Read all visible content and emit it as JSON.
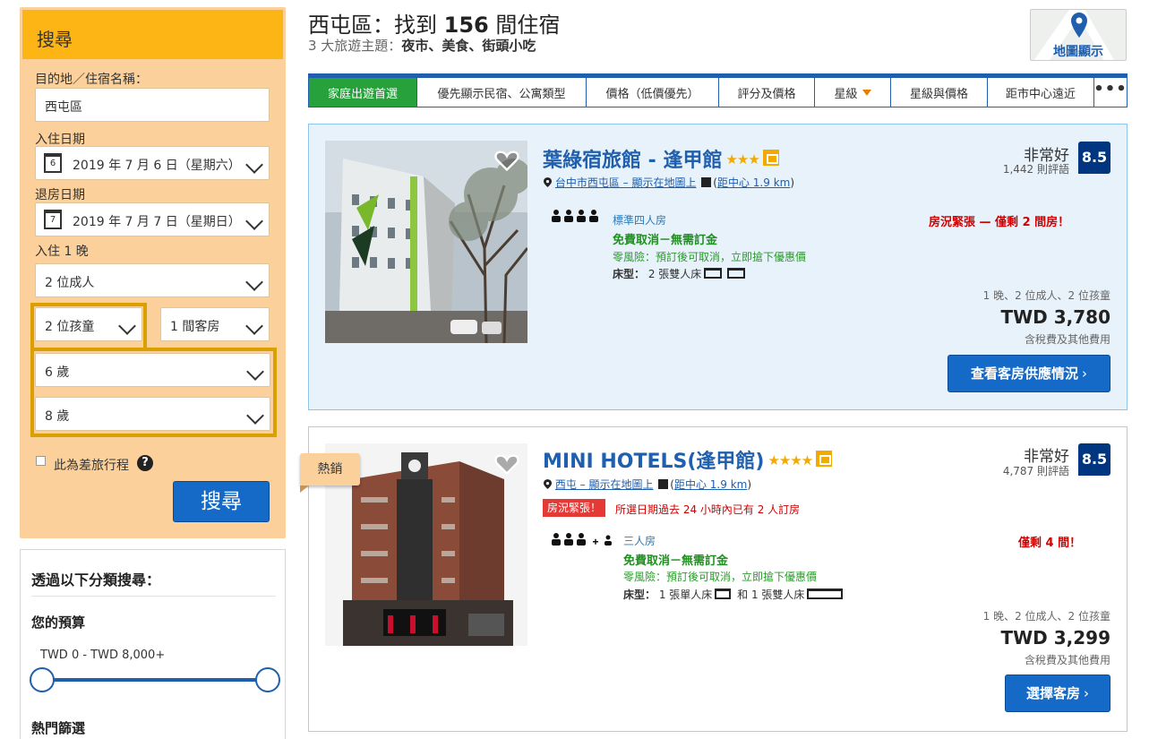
{
  "search": {
    "header": "搜尋",
    "destination_label": "目的地／住宿名稱：",
    "destination_value": "西屯區",
    "checkin_label": "入住日期",
    "checkin_day": "6",
    "checkin_value": "2019 年 7 月 6 日（星期六）",
    "checkout_label": "退房日期",
    "checkout_day": "7",
    "checkout_value": "2019 年 7 月 7 日（星期日）",
    "nights_label": "入住 1 晚",
    "adults": "2 位成人",
    "children": "2 位孩童",
    "rooms": "1 間客房",
    "child_age_1": "6 歲",
    "child_age_2": "8 歲",
    "business_trip_label": "此為差旅行程",
    "help": "?",
    "button": "搜尋"
  },
  "filters": {
    "title": "透過以下分類搜尋：",
    "budget_title": "您的預算",
    "budget_range": "TWD 0 - TWD 8,000+",
    "popular_title": "熱門篩選"
  },
  "header": {
    "title_prefix": "西屯區：找到 ",
    "title_count": "156",
    "title_suffix": " 間住宿",
    "subtitle_prefix": "3 大旅遊主題：",
    "subtitle_themes": "夜市、美食、街頭小吃",
    "map_button": "地圖顯示"
  },
  "sort_tabs": [
    {
      "label": "家庭出遊首選"
    },
    {
      "label": "優先顯示民宿、公寓類型"
    },
    {
      "label": "價格（低價優先）"
    },
    {
      "label": "評分及價格"
    },
    {
      "label": "星級"
    },
    {
      "label": "星級與價格"
    },
    {
      "label": "距市中心遠近"
    },
    {
      "label": "•••"
    }
  ],
  "hotels": [
    {
      "name": "葉綠宿旅館 - 逢甲館",
      "stars": "★★★",
      "location_link": "台中市西屯區 – 顯示在地圖上",
      "distance": "距中心 1.9 km",
      "rating_word": "非常好",
      "review_count": "1,442 則評語",
      "score": "8.5",
      "room_type": "標準四人房",
      "free_cancel": "免費取消－無需訂金",
      "no_risk": "零風險：預訂後可取消，立即搶下優惠價",
      "bed_label": "床型：",
      "bed_text": "2 張雙人床",
      "urgent": "房況緊張 — 僅剩 2 間房！",
      "stay_info": "1 晚、2 位成人、2 位孩童",
      "price": "TWD 3,780",
      "tax_note": "含稅費及其他費用",
      "button": "查看客房供應情況"
    },
    {
      "badge": "熱銷",
      "name": "MINI HOTELS(逢甲館)",
      "stars": "★★★★",
      "location_link": "西屯 – 顯示在地圖上",
      "distance": "距中心 1.9 km",
      "rating_word": "非常好",
      "review_count": "4,787 則評語",
      "score": "8.5",
      "urgent_tag": "房況緊張！",
      "urgent_note": "所選日期過去 24 小時內已有 2 人訂房",
      "room_type": "三人房",
      "free_cancel": "免費取消－無需訂金",
      "no_risk": "零風險：預訂後可取消，立即搶下優惠價",
      "bed_label": "床型：",
      "bed_text_1": "1 張單人床",
      "bed_text_and": "和",
      "bed_text_2": "1 張雙人床",
      "urgent": "僅剩 4 間！",
      "stay_info": "1 晚、2 位成人、2 位孩童",
      "price": "TWD 3,299",
      "tax_note": "含稅費及其他費用",
      "button": "選擇客房"
    }
  ],
  "colors": {
    "brand_blue": "#1f5fad",
    "button_blue": "#1569c7",
    "search_yellow": "#fcb515",
    "panel_peach": "#fcd09a",
    "active_tab_green": "#27a13b",
    "score_navy": "#003580",
    "urgent_red": "#d40000"
  }
}
